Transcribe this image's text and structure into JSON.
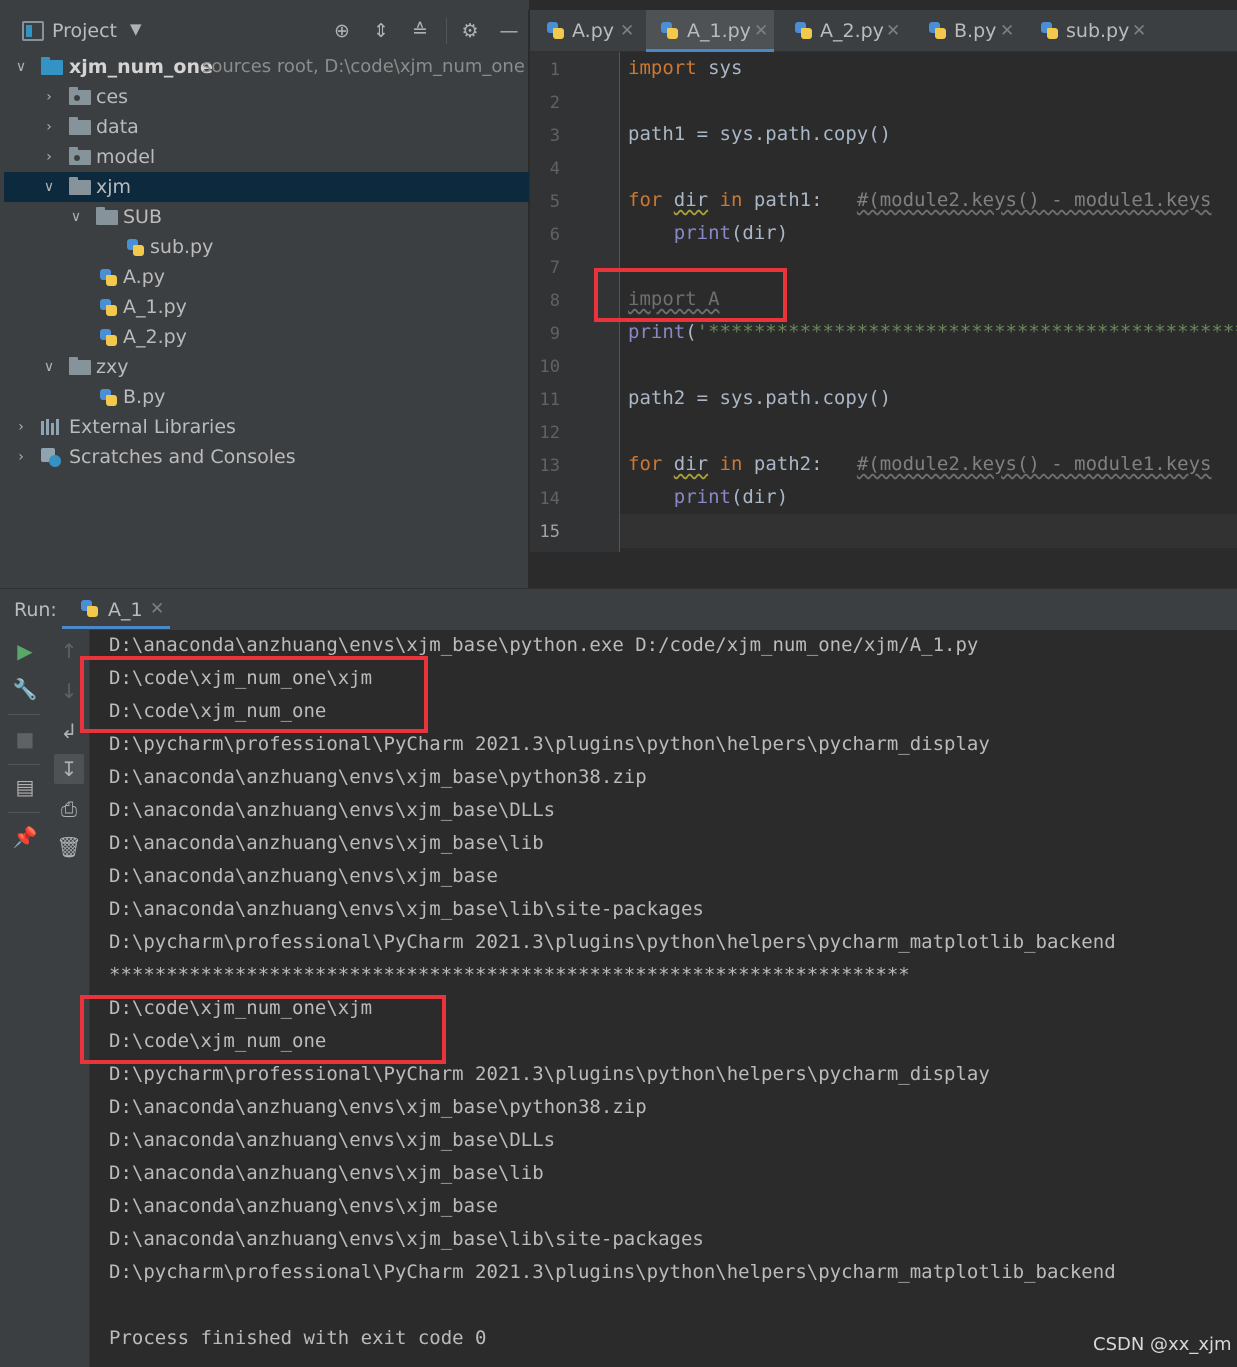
{
  "project": {
    "title": "Project",
    "root_name": "xjm_num_one",
    "root_hint": "sources root,  D:\\code\\xjm_num_one",
    "items": [
      {
        "label": "ces"
      },
      {
        "label": "data"
      },
      {
        "label": "model"
      },
      {
        "label": "xjm"
      },
      {
        "label": "SUB"
      },
      {
        "label": "sub.py"
      },
      {
        "label": "A.py"
      },
      {
        "label": "A_1.py"
      },
      {
        "label": "A_2.py"
      },
      {
        "label": "zxy"
      },
      {
        "label": "B.py"
      },
      {
        "label": "External Libraries"
      },
      {
        "label": "Scratches and Consoles"
      }
    ]
  },
  "tabs": [
    {
      "label": "A.py"
    },
    {
      "label": "A_1.py"
    },
    {
      "label": "A_2.py"
    },
    {
      "label": "B.py"
    },
    {
      "label": "sub.py"
    }
  ],
  "editor": {
    "line_numbers": [
      "1",
      "2",
      "3",
      "4",
      "5",
      "6",
      "7",
      "8",
      "9",
      "10",
      "11",
      "12",
      "13",
      "14",
      "15"
    ],
    "lines": {
      "l1_kw": "import",
      "l1_rest": " sys",
      "l3": "path1 = sys.path.copy()",
      "l5_kw": "for",
      "l5_var": "dir",
      "l5_in": "in",
      "l5_rest": " path1:   ",
      "l5_cm": "#(module2.keys() - module1.keys",
      "l6_fn": "print",
      "l6_rest": "(dir)",
      "l8": "import A",
      "l9_fn": "print",
      "l9_p": "(",
      "l9_st": "'*****************************************************",
      "l11": "path2 = sys.path.copy()",
      "l13_kw": "for",
      "l13_var": "dir",
      "l13_in": "in",
      "l13_rest": " path2:   ",
      "l13_cm": "#(module2.keys() - module1.keys",
      "l14_fn": "print",
      "l14_rest": "(dir)"
    }
  },
  "run": {
    "label": "Run:",
    "tab": "A_1",
    "lines": [
      "D:\\anaconda\\anzhuang\\envs\\xjm_base\\python.exe D:/code/xjm_num_one/xjm/A_1.py",
      "D:\\code\\xjm_num_one\\xjm",
      "D:\\code\\xjm_num_one",
      "D:\\pycharm\\professional\\PyCharm 2021.3\\plugins\\python\\helpers\\pycharm_display",
      "D:\\anaconda\\anzhuang\\envs\\xjm_base\\python38.zip",
      "D:\\anaconda\\anzhuang\\envs\\xjm_base\\DLLs",
      "D:\\anaconda\\anzhuang\\envs\\xjm_base\\lib",
      "D:\\anaconda\\anzhuang\\envs\\xjm_base",
      "D:\\anaconda\\anzhuang\\envs\\xjm_base\\lib\\site-packages",
      "D:\\pycharm\\professional\\PyCharm 2021.3\\plugins\\python\\helpers\\pycharm_matplotlib_backend",
      "**********************************************************************",
      "D:\\code\\xjm_num_one\\xjm",
      "D:\\code\\xjm_num_one",
      "D:\\pycharm\\professional\\PyCharm 2021.3\\plugins\\python\\helpers\\pycharm_display",
      "D:\\anaconda\\anzhuang\\envs\\xjm_base\\python38.zip",
      "D:\\anaconda\\anzhuang\\envs\\xjm_base\\DLLs",
      "D:\\anaconda\\anzhuang\\envs\\xjm_base\\lib",
      "D:\\anaconda\\anzhuang\\envs\\xjm_base",
      "D:\\anaconda\\anzhuang\\envs\\xjm_base\\lib\\site-packages",
      "D:\\pycharm\\professional\\PyCharm 2021.3\\plugins\\python\\helpers\\pycharm_matplotlib_backend",
      "",
      "Process finished with exit code 0"
    ]
  },
  "watermark": "CSDN @xx_xjm",
  "colors": {
    "highlight_box": "#e8343a",
    "keyword": "#cc7832",
    "builtin": "#8888c6",
    "string": "#6a8759",
    "comment": "#808080",
    "tab_underline": "#4a88c7",
    "selection": "#0d293e"
  }
}
